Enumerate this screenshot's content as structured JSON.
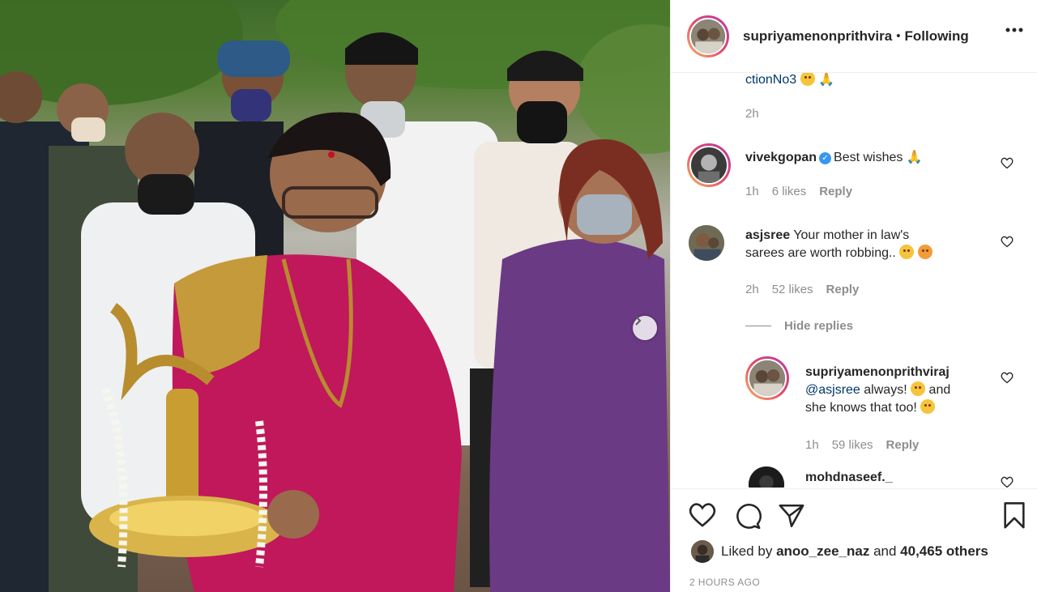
{
  "post": {
    "username": "supriyamenonprithvira",
    "separator": "•",
    "follow_status": "Following",
    "likes_prefix": "Liked by",
    "likes_user": "anoo_zee_naz",
    "likes_and": "and",
    "likes_count": "40,465 others",
    "timestamp": "2 HOURS AGO"
  },
  "caption_tail": {
    "text": "ctionNo3",
    "time": "2h"
  },
  "comments": [
    {
      "username": "vivekgopan",
      "verified": true,
      "text": "Best wishes",
      "time": "1h",
      "likes": "6 likes",
      "reply": "Reply"
    },
    {
      "username": "asjsree",
      "text_line1": "Your mother in law's",
      "text_line2": "sarees are worth robbing..",
      "time": "2h",
      "likes": "52 likes",
      "reply": "Reply",
      "hide_replies": "Hide replies",
      "replies": [
        {
          "username": "supriyamenonprithviraj",
          "mention": "@asjsree",
          "text_line1": "always!",
          "text_mid": "and",
          "text_line2": "she knows that too!",
          "time": "1h",
          "likes": "59 likes",
          "reply": "Reply"
        }
      ]
    },
    {
      "username": "mohdnaseef._"
    }
  ],
  "icons": {
    "more": "more-horizontal-icon",
    "like": "heart-icon",
    "comment": "comment-icon",
    "share": "share-icon",
    "save": "bookmark-icon",
    "next": "chevron-right-icon"
  },
  "colors": {
    "text": "#262626",
    "secondary": "#8e8e8e",
    "border": "#efefef",
    "verified": "#3897f0",
    "story_ring_start": "#f9b45b",
    "story_ring_end": "#b73aa8"
  }
}
